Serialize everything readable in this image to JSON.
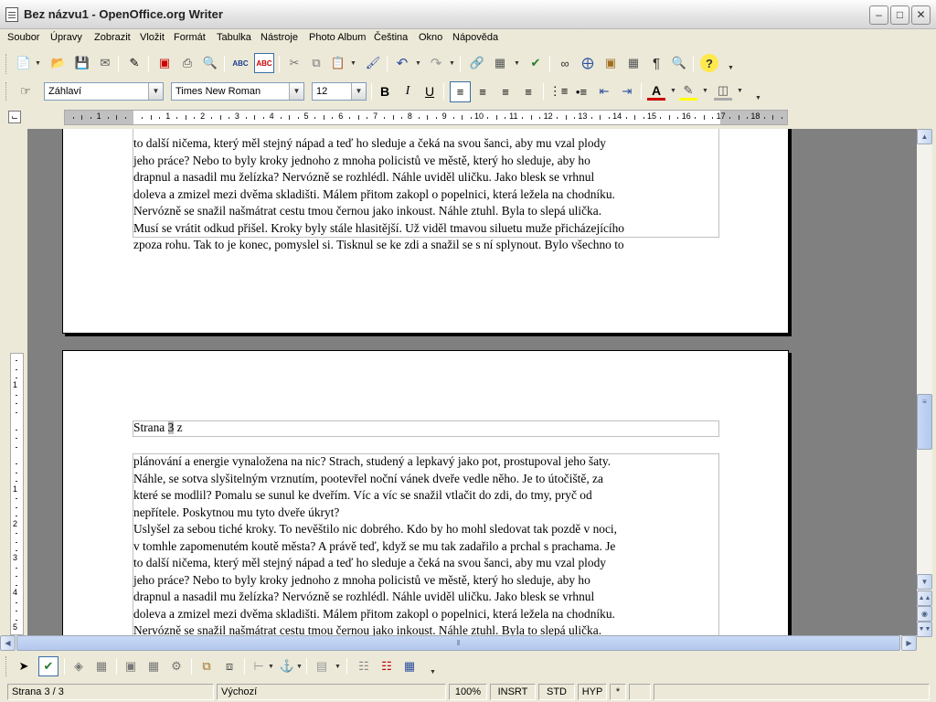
{
  "window": {
    "title": "Bez názvu1 - OpenOffice.org Writer"
  },
  "menu": [
    "Soubor",
    "Úpravy",
    "Zobrazit",
    "Vložit",
    "Formát",
    "Tabulka",
    "Nástroje",
    "Photo Album",
    "Čeština",
    "Okno",
    "Nápověda"
  ],
  "format_toolbar": {
    "style": "Záhlaví",
    "font": "Times New Roman",
    "size": "12"
  },
  "ruler": {
    "labels": [
      "1",
      "1",
      "2",
      "3",
      "4",
      "5",
      "6",
      "7",
      "8",
      "9",
      "10",
      "11",
      "12",
      "13",
      "14",
      "15",
      "16",
      "17",
      "18"
    ],
    "vlabels": [
      "1",
      "1",
      "2",
      "3",
      "4",
      "5",
      "6"
    ]
  },
  "document": {
    "page1_lines": [
      "to další ničema, který měl stejný nápad a teď ho sleduje a čeká na svou šanci, aby mu vzal plody",
      "jeho práce? Nebo to byly kroky jednoho z mnoha policistů ve městě, který ho sleduje, aby ho",
      "drapnul a nasadil mu želízka? Nervózně se rozhlédl. Náhle uviděl uličku. Jako blesk se vrhnul",
      "doleva a zmizel mezi dvěma skladišti. Málem přitom zakopl o popelnici, která ležela na chodníku.",
      "Nervózně se snažil našmátrat cestu tmou černou jako inkoust. Náhle ztuhl. Byla to slepá ulička.",
      "Musí se vrátit odkud přišel. Kroky byly stále hlasitější. Už viděl tmavou siluetu muže přicházejícího",
      "zpoza rohu. Tak to je konec, pomyslel si. Tisknul se ke zdi a snažil se s ní splynout. Bylo všechno to"
    ],
    "header_prefix": "Strana ",
    "header_field": "3",
    "header_suffix": " z",
    "page2_lines": [
      "plánování a energie vynaložena na nic? Strach, studený a lepkavý jako pot, prostupoval jeho šaty.",
      "Náhle, se sotva slyšitelným vrznutím, pootevřel noční vánek dveře vedle něho. Je to útočiště, za",
      "které se modlil? Pomalu se sunul ke dveřím. Víc a víc se snažil vtlačit do zdi, do tmy, pryč od",
      "nepřítele. Poskytnou mu tyto dveře úkryt?",
      "Uslyšel za sebou tiché kroky. To nevěštilo nic dobrého. Kdo by ho mohl sledovat tak pozdě v noci,",
      "v tomhle zapomenutém koutě města? A právě teď, když se mu tak zadařilo a prchal s prachama. Je",
      "to další ničema, který měl stejný nápad a teď ho sleduje a čeká na svou šanci, aby mu vzal plody",
      "jeho práce? Nebo to byly kroky jednoho z mnoha policistů ve městě, který ho sleduje, aby ho",
      "drapnul a nasadil mu želízka? Nervózně se rozhlédl. Náhle uviděl uličku. Jako blesk se vrhnul",
      "doleva a zmizel mezi dvěma skladišti. Málem přitom zakopl o popelnici, která ležela na chodníku.",
      "Nervózně se snažil našmátrat cestu tmou černou jako inkoust. Náhle ztuhl. Byla to slepá ulička."
    ]
  },
  "status": {
    "page": "Strana 3 / 3",
    "style": "Výchozí",
    "zoom": "100%",
    "insert": "INSRT",
    "selection": "STD",
    "hyphen": "HYP",
    "modified": "*"
  },
  "colors": {
    "accent": "#3a6ea5",
    "page_bg": "#ffffff",
    "doc_bg": "#808080"
  }
}
